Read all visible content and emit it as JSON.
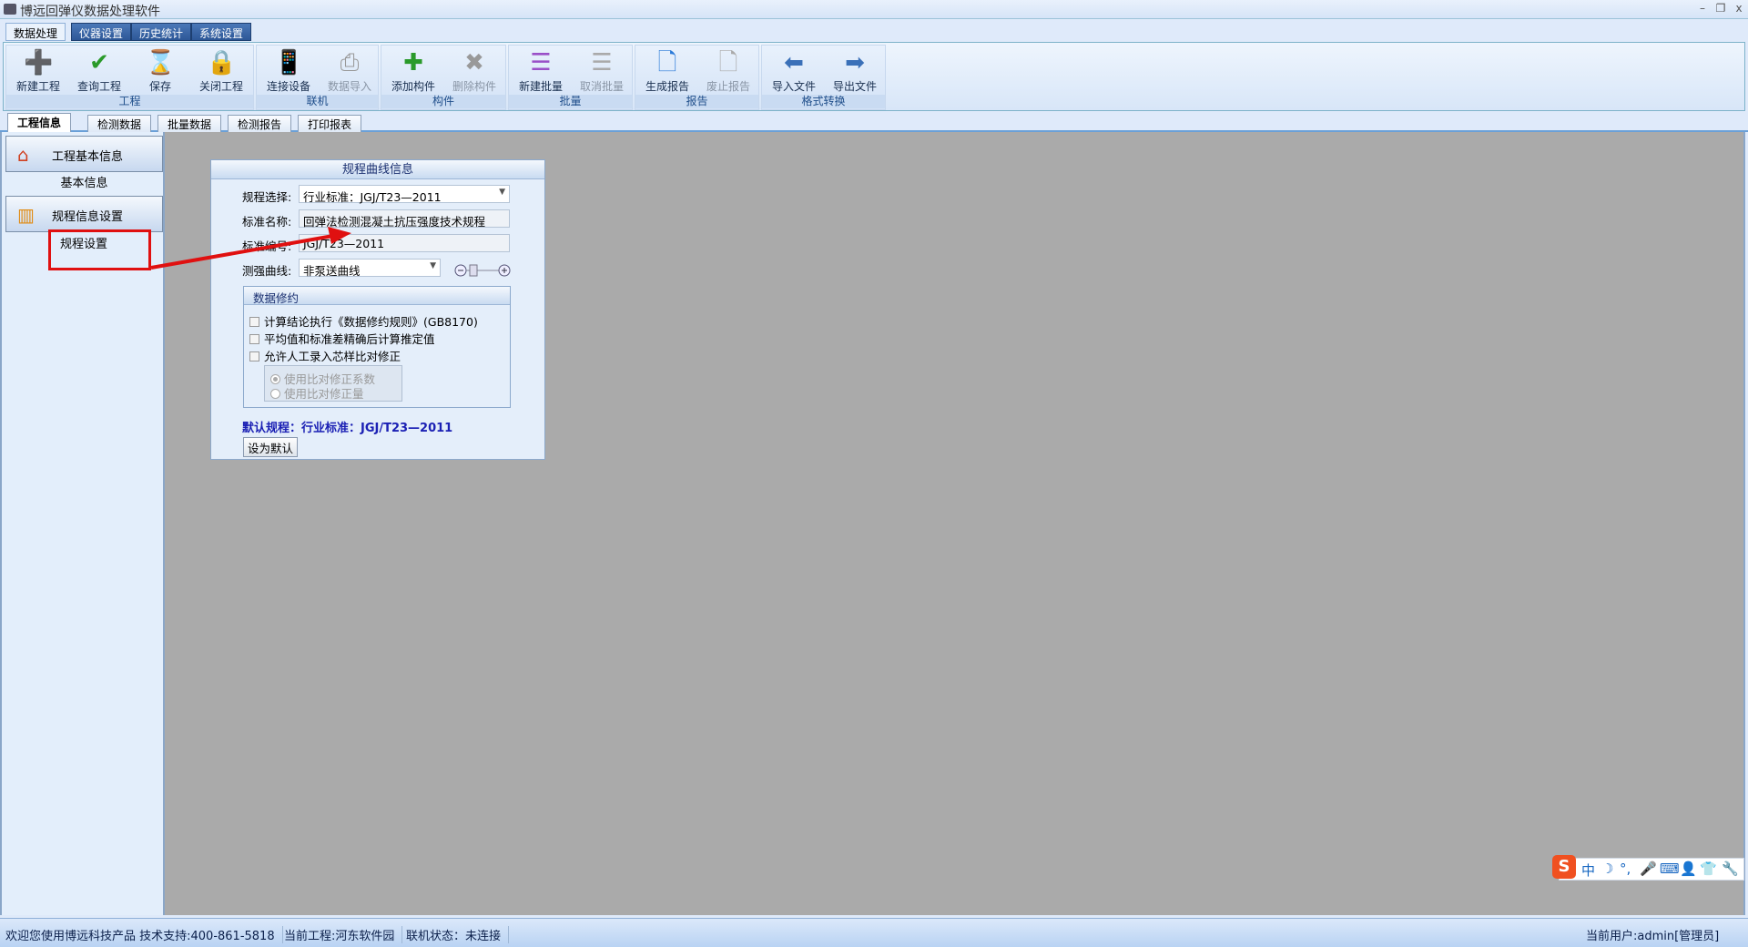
{
  "window": {
    "title": "博远回弹仪数据处理软件",
    "min": "–",
    "max": "❐",
    "close": "x"
  },
  "menu_tabs": [
    "数据处理",
    "仪器设置",
    "历史统计",
    "系统设置"
  ],
  "ribbon": {
    "groups": [
      {
        "label": "工程",
        "buttons": [
          {
            "label": "新建工程",
            "icon": "➕",
            "color": "#3a8ad8"
          },
          {
            "label": "查询工程",
            "icon": "✔",
            "color": "#2a9a2a"
          },
          {
            "label": "保存",
            "icon": "⌛",
            "color": "#c88020"
          },
          {
            "label": "关闭工程",
            "icon": "🔒",
            "color": "#d8a010"
          }
        ]
      },
      {
        "label": "联机",
        "buttons": [
          {
            "label": "连接设备",
            "icon": "📱",
            "color": "#2a7ad8"
          },
          {
            "label": "数据导入",
            "icon": "⎙",
            "color": "#999",
            "disabled": true
          }
        ]
      },
      {
        "label": "构件",
        "buttons": [
          {
            "label": "添加构件",
            "icon": "✚",
            "color": "#2a9a2a"
          },
          {
            "label": "删除构件",
            "icon": "✖",
            "color": "#999",
            "disabled": true
          }
        ]
      },
      {
        "label": "批量",
        "buttons": [
          {
            "label": "新建批量",
            "icon": "☰",
            "color": "#9a50c8"
          },
          {
            "label": "取消批量",
            "icon": "☰",
            "color": "#aaa",
            "disabled": true
          }
        ]
      },
      {
        "label": "报告",
        "buttons": [
          {
            "label": "生成报告",
            "icon": "🗋",
            "color": "#2a7ad8"
          },
          {
            "label": "废止报告",
            "icon": "🗋",
            "color": "#aaa",
            "disabled": true
          }
        ]
      },
      {
        "label": "格式转换",
        "buttons": [
          {
            "label": "导入文件",
            "icon": "⬅",
            "color": "#3a70b8"
          },
          {
            "label": "导出文件",
            "icon": "➡",
            "color": "#3a70b8"
          }
        ]
      }
    ]
  },
  "doc_tabs": [
    "工程信息",
    "检测数据",
    "批量数据",
    "检测报告",
    "打印报表"
  ],
  "sidebar": {
    "sections": [
      {
        "header": "工程基本信息",
        "items": [
          "基本信息"
        ]
      },
      {
        "header": "规程信息设置",
        "items": [
          "规程设置"
        ]
      }
    ]
  },
  "panel": {
    "title": "规程曲线信息",
    "spec_label": "规程选择:",
    "spec_value": "行业标准：JGJ/T23—2011",
    "name_label": "标准名称:",
    "name_value": "回弹法检测混凝土抗压强度技术规程",
    "code_label": "标准编号:",
    "code_value": "JGJ/T23—2011",
    "curve_label": "测强曲线:",
    "curve_value": "非泵送曲线",
    "rounding": {
      "title": "数据修约",
      "options": [
        {
          "label": "计算结论执行《数据修约规则》(GB8170)",
          "checked": false
        },
        {
          "label": "平均值和标准差精确后计算推定值",
          "checked": false
        },
        {
          "label": "允许人工录入芯样比对修正",
          "checked": false
        }
      ],
      "radios": [
        {
          "label": "使用比对修正系数",
          "selected": true
        },
        {
          "label": "使用比对修正量",
          "selected": false
        }
      ]
    },
    "default_text": "默认规程：行业标准：JGJ/T23—2011",
    "set_default": "设为默认"
  },
  "status": {
    "welcome": "欢迎您使用博远科技产品 技术支持:400-861-5818",
    "project": "当前工程:河东软件园",
    "connection": "联机状态：未连接",
    "user": "当前用户:admin[管理员]"
  },
  "ime": {
    "logo": "S",
    "items": [
      "中",
      "☽",
      "°,",
      "🎤",
      "⌨",
      "👤",
      "👕",
      "🔧"
    ]
  }
}
